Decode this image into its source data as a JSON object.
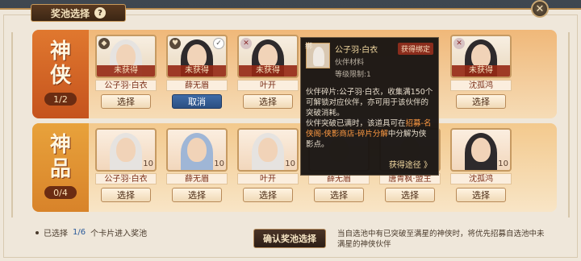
{
  "header": {
    "title": "奖池选择",
    "help": "?"
  },
  "tiers": [
    {
      "char1": "神",
      "char2": "侠",
      "count": "1/2",
      "cards": [
        {
          "name": "公子羽·白衣",
          "status": "未获得",
          "button": "选择",
          "hair": "white",
          "badge": "shield"
        },
        {
          "name": "薛无眉",
          "status": "未获得",
          "button": "取消",
          "hair": "dark",
          "badge": "heart",
          "checked": true
        },
        {
          "name": "叶开",
          "status": "未获得",
          "button": "选择",
          "hair": "dark",
          "badge": "x"
        },
        {
          "name": "",
          "status": "",
          "button": "",
          "hair": "none"
        },
        {
          "name": "",
          "status": "",
          "button": "",
          "hair": "none"
        },
        {
          "name": "沈孤鸿",
          "status": "未获得",
          "button": "选择",
          "hair": "dark",
          "badge": "x"
        }
      ]
    },
    {
      "char1": "神",
      "char2": "品",
      "count": "0/4",
      "cards": [
        {
          "name": "公子羽·白衣",
          "button": "选择",
          "hair": "white",
          "num": "10"
        },
        {
          "name": "薛无眉",
          "button": "选择",
          "hair": "blue",
          "num": "10"
        },
        {
          "name": "叶开",
          "button": "选择",
          "hair": "white",
          "num": "10"
        },
        {
          "name": "薛无眉",
          "button": "选择",
          "hair": "none",
          "num": ""
        },
        {
          "name": "唐青枫·盟主",
          "button": "选择",
          "hair": "none",
          "num": ""
        },
        {
          "name": "沈孤鸿",
          "button": "选择",
          "hair": "dark",
          "num": "10"
        }
      ]
    }
  ],
  "tooltip": {
    "title": "公子羽·白衣",
    "type": "伙伴材料",
    "level": "等级限制:1",
    "badge": "获得绑定",
    "lock": "绑",
    "desc1": "伙伴碎片:公子羽·白衣，收集满150个可解锁对应伙伴，亦可用于该伙伴的突破消耗。",
    "desc2a": "伙伴突破已满时，该道具可在",
    "desc2b": "招募-名侠阁-侠影商店-碎片分解",
    "desc2c": "中分解为侠影点。",
    "footer": "获得途径 》"
  },
  "footer": {
    "left_pre": "已选择",
    "left_count": "1/6",
    "left_post": "个卡片进入奖池",
    "confirm": "确认奖池选择",
    "right": "当自选池中有已突破至满星的神侠时，将优先招募自选池中未满星的神侠伙伴"
  },
  "colors": {
    "tier_top": "#c5531d",
    "tier_bottom": "#d8832a",
    "cancel_btn": "#2b4f82",
    "tooltip_highlight": "#ff9a42"
  }
}
